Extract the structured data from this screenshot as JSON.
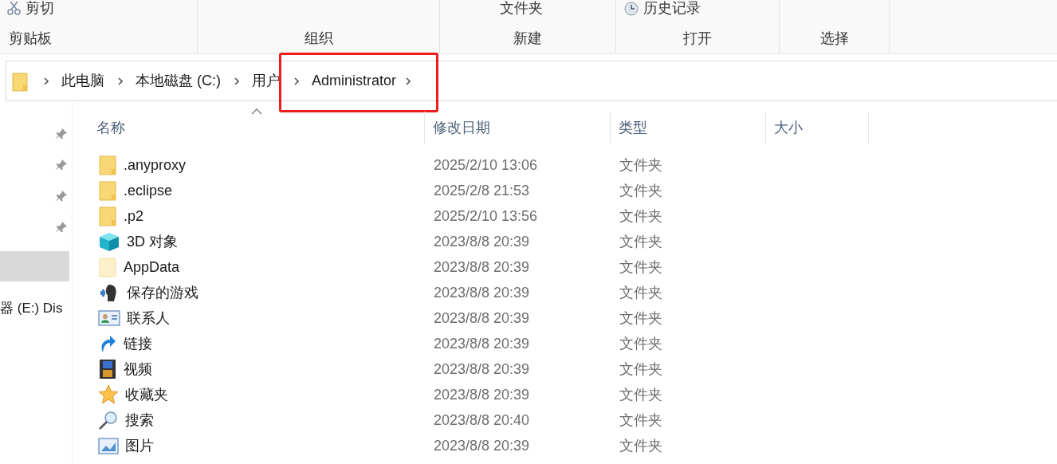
{
  "ribbon": {
    "top_items": [
      {
        "kind": "cut",
        "label": "剪切"
      },
      {
        "kind": "text",
        "label": "文件夹"
      },
      {
        "kind": "history",
        "label": "历史记录"
      }
    ],
    "groups": [
      {
        "label": "剪贴板"
      },
      {
        "label": "组织"
      },
      {
        "label": "新建"
      },
      {
        "label": "打开"
      },
      {
        "label": "选择"
      }
    ]
  },
  "breadcrumb": [
    {
      "label": "此电脑",
      "highlighted": false
    },
    {
      "label": "本地磁盘 (C:)",
      "highlighted": false
    },
    {
      "label": "用户",
      "highlighted": false
    },
    {
      "label": "Administrator",
      "highlighted": true
    }
  ],
  "navigation": [
    {
      "pinned": true,
      "selected": false
    },
    {
      "pinned": true,
      "selected": false
    },
    {
      "pinned": true,
      "selected": false
    },
    {
      "pinned": true,
      "selected": false
    },
    {
      "pinned": false,
      "selected": true
    },
    {
      "pinned": false,
      "selected": false,
      "label": "器 (E:) Dis"
    }
  ],
  "table": {
    "columns": [
      {
        "label": "名称",
        "sorted": true
      },
      {
        "label": "修改日期",
        "sorted": false
      },
      {
        "label": "类型",
        "sorted": false
      },
      {
        "label": "大小",
        "sorted": false
      }
    ],
    "rows": [
      {
        "kind": "folder",
        "name": ".anyproxy",
        "modified": "2025/2/10 13:06",
        "type": "文件夹"
      },
      {
        "kind": "folder",
        "name": ".eclipse",
        "modified": "2025/2/8 21:53",
        "type": "文件夹"
      },
      {
        "kind": "folder",
        "name": ".p2",
        "modified": "2025/2/10 13:56",
        "type": "文件夹"
      },
      {
        "kind": "objects3d",
        "name": "3D 对象",
        "modified": "2023/8/8 20:39",
        "type": "文件夹"
      },
      {
        "kind": "hidden-folder",
        "name": "AppData",
        "modified": "2023/8/8 20:39",
        "type": "文件夹"
      },
      {
        "kind": "games",
        "name": "保存的游戏",
        "modified": "2023/8/8 20:39",
        "type": "文件夹"
      },
      {
        "kind": "contacts",
        "name": "联系人",
        "modified": "2023/8/8 20:39",
        "type": "文件夹"
      },
      {
        "kind": "links",
        "name": "链接",
        "modified": "2023/8/8 20:39",
        "type": "文件夹"
      },
      {
        "kind": "videos",
        "name": "视频",
        "modified": "2023/8/8 20:39",
        "type": "文件夹"
      },
      {
        "kind": "favorites",
        "name": "收藏夹",
        "modified": "2023/8/8 20:39",
        "type": "文件夹"
      },
      {
        "kind": "searches",
        "name": "搜索",
        "modified": "2023/8/8 20:40",
        "type": "文件夹"
      },
      {
        "kind": "pictures",
        "name": "图片",
        "modified": "2023/8/8 20:39",
        "type": "文件夹"
      }
    ]
  }
}
